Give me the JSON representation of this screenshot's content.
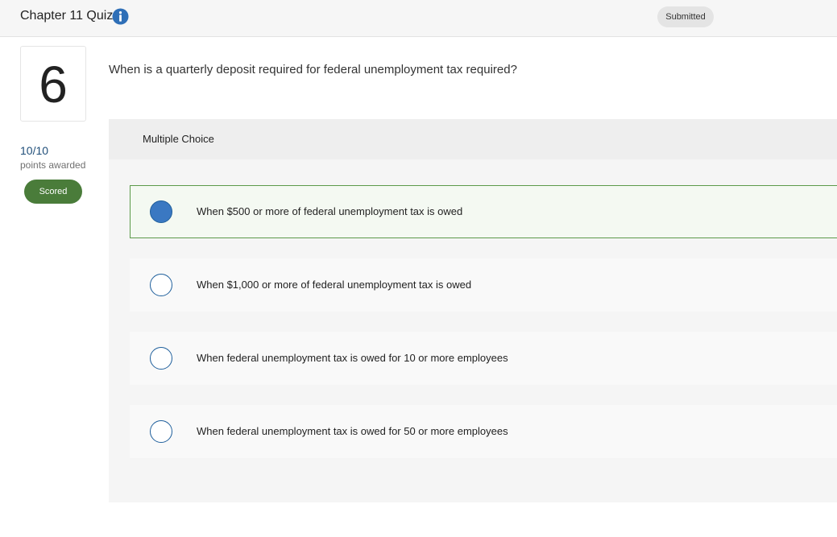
{
  "header": {
    "title": "Chapter 11 Quiz",
    "info_icon": "info-circle-icon",
    "status": "Submitted"
  },
  "question": {
    "number": "6",
    "points": "10/10",
    "points_label": "points awarded",
    "scored_label": "Scored",
    "text": "When is a quarterly deposit required for federal unemployment tax required?"
  },
  "answer_panel": {
    "type_label": "Multiple Choice",
    "choices": [
      {
        "label": "When $500 or more of federal unemployment tax is owed",
        "selected": true
      },
      {
        "label": "When $1,000 or more of federal unemployment tax is owed",
        "selected": false
      },
      {
        "label": "When federal unemployment tax is owed for 10 or more employees",
        "selected": false
      },
      {
        "label": "When federal unemployment tax is owed for 50 or more employees",
        "selected": false
      }
    ]
  },
  "colors": {
    "accent_blue": "#3a78c2",
    "scored_green": "#4a7c3a",
    "selected_border": "#5c9a4a",
    "points_blue": "#1f4e79"
  }
}
